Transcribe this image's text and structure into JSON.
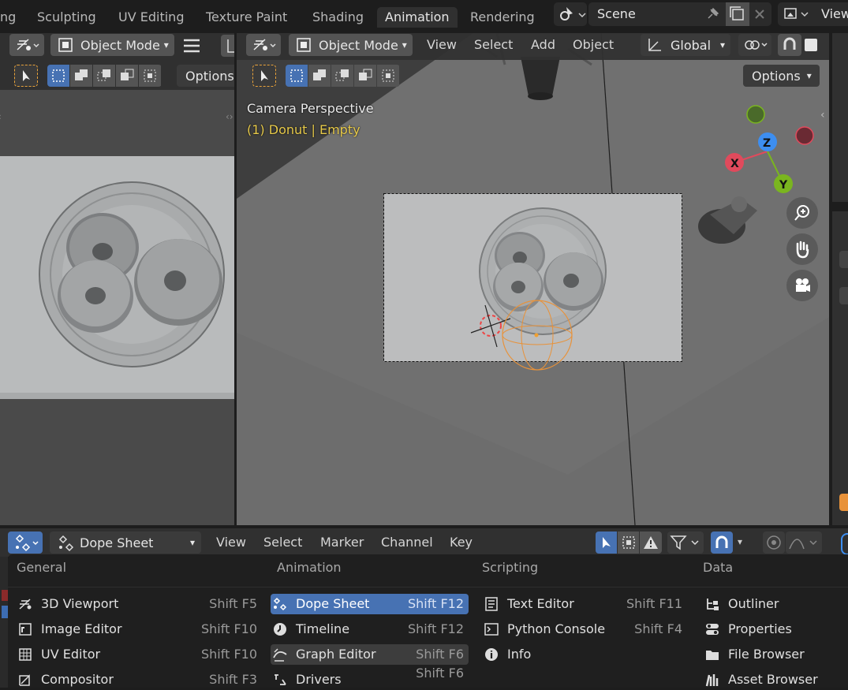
{
  "workspace_tabs": [
    {
      "label": "ng"
    },
    {
      "label": "Sculpting"
    },
    {
      "label": "UV Editing"
    },
    {
      "label": "Texture Paint"
    },
    {
      "label": "Shading"
    },
    {
      "label": "Animation"
    },
    {
      "label": "Rendering"
    }
  ],
  "active_tab": "Animation",
  "scene": {
    "name": "Scene"
  },
  "view_layer": {
    "label": "View"
  },
  "left_header": {
    "mode": "Object Mode",
    "options": "Options"
  },
  "main_header": {
    "mode": "Object Mode",
    "menus": [
      "View",
      "Select",
      "Add",
      "Object"
    ],
    "orientation": "Global",
    "options": "Options"
  },
  "viewport_overlay": {
    "title": "Camera Perspective",
    "subtitle": "(1) Donut | Empty"
  },
  "gizmo": {
    "x": "X",
    "y": "Y",
    "z": "Z"
  },
  "dopesheet_header": {
    "editor": "Dope Sheet",
    "menus": [
      "View",
      "Select",
      "Marker",
      "Channel",
      "Key"
    ]
  },
  "editor_menu": {
    "columns": [
      {
        "heading": "General",
        "items": [
          {
            "label": "3D Viewport",
            "shortcut": "Shift F5",
            "icon": "viewport-3d-icon"
          },
          {
            "label": "Image Editor",
            "shortcut": "Shift F10",
            "icon": "image-editor-icon"
          },
          {
            "label": "UV Editor",
            "shortcut": "Shift F10",
            "icon": "uv-editor-icon"
          },
          {
            "label": "Compositor",
            "shortcut": "Shift F3",
            "icon": "compositor-icon"
          }
        ]
      },
      {
        "heading": "Animation",
        "items": [
          {
            "label": "Dope Sheet",
            "shortcut": "Shift F12",
            "icon": "dope-sheet-icon",
            "state": "highlighted"
          },
          {
            "label": "Timeline",
            "shortcut": "Shift F12",
            "icon": "timeline-icon"
          },
          {
            "label": "Graph Editor",
            "shortcut": "Shift F6",
            "icon": "graph-editor-icon",
            "state": "hover"
          },
          {
            "label": "Drivers",
            "shortcut": "Shift F6",
            "icon": "drivers-icon"
          }
        ]
      },
      {
        "heading": "Scripting",
        "items": [
          {
            "label": "Text Editor",
            "shortcut": "Shift F11",
            "icon": "text-editor-icon"
          },
          {
            "label": "Python Console",
            "shortcut": "Shift F4",
            "icon": "python-console-icon"
          },
          {
            "label": "Info",
            "shortcut": "",
            "icon": "info-icon"
          }
        ]
      },
      {
        "heading": "Data",
        "items": [
          {
            "label": "Outliner",
            "shortcut": "",
            "icon": "outliner-icon"
          },
          {
            "label": "Properties",
            "shortcut": "",
            "icon": "properties-icon"
          },
          {
            "label": "File Browser",
            "shortcut": "",
            "icon": "file-browser-icon"
          },
          {
            "label": "Asset Browser",
            "shortcut": "",
            "icon": "asset-browser-icon"
          }
        ]
      }
    ]
  },
  "colors": {
    "accent": "#4772b3",
    "overlay_text": "#e6c94a",
    "x_axis": "#e04a5c",
    "y_axis": "#7ab51f",
    "z_axis": "#3d8ef0"
  }
}
